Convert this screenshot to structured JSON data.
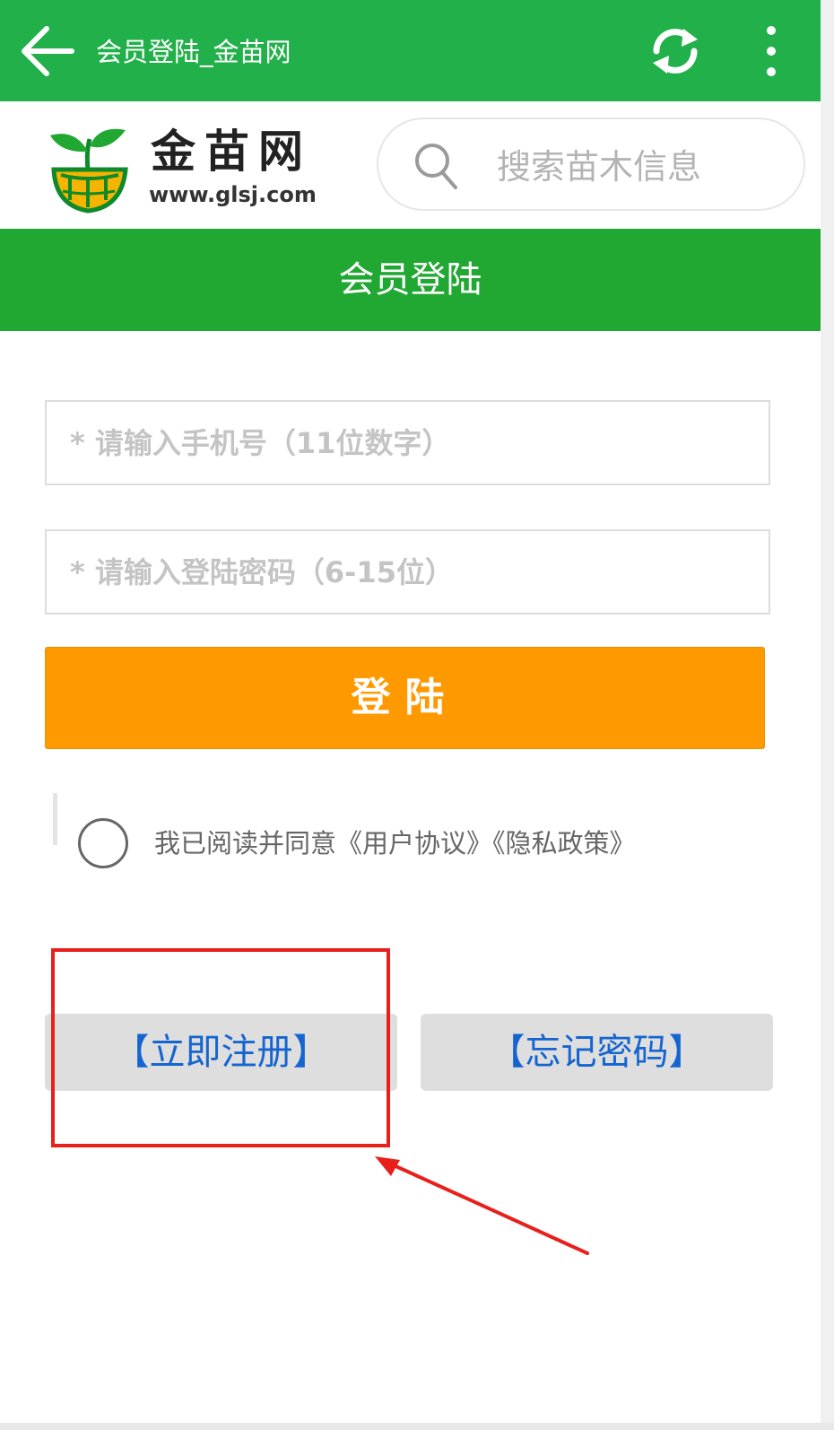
{
  "appbar": {
    "title": "会员登陆_金苗网",
    "back_icon": "arrow-left-icon",
    "refresh_icon": "refresh-icon",
    "more_icon": "more-vert-icon"
  },
  "header": {
    "logo_text": "金苗网",
    "logo_url": "www.glsj.com",
    "search_placeholder": "搜索苗木信息"
  },
  "section": {
    "title": "会员登陆"
  },
  "form": {
    "phone_placeholder": "* 请输入手机号（11位数字）",
    "password_placeholder": "* 请输入登陆密码（6-15位）",
    "login_label": "登陆",
    "agree_prefix": "我已阅读并同意",
    "user_agreement": "《用户协议》",
    "privacy_policy": "《隐私政策》"
  },
  "actions": {
    "register_label": "【立即注册】",
    "forgot_label": "【忘记密码】"
  },
  "colors": {
    "appbar": "#22b04b",
    "section_bar": "#21a832",
    "login_button": "#ff9900",
    "link_blue": "#1565d0",
    "annotation_red": "#e8201b"
  }
}
